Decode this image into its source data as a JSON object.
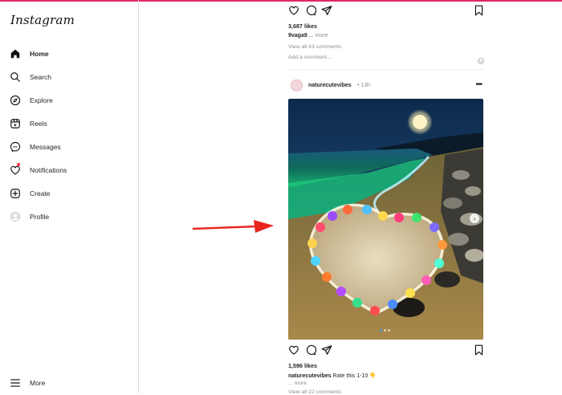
{
  "sidebar": {
    "logo": "Instagram",
    "items": [
      {
        "label": "Home",
        "icon": "home-icon"
      },
      {
        "label": "Search",
        "icon": "search-icon"
      },
      {
        "label": "Explore",
        "icon": "compass-icon"
      },
      {
        "label": "Reels",
        "icon": "reels-icon"
      },
      {
        "label": "Messages",
        "icon": "messenger-icon"
      },
      {
        "label": "Notifications",
        "icon": "heart-icon"
      },
      {
        "label": "Create",
        "icon": "plus-square-icon"
      },
      {
        "label": "Profile",
        "icon": "profile-avatar-icon"
      }
    ],
    "more_label": "More"
  },
  "prev_post": {
    "likes": "3,687 likes",
    "caption_user": "9vaga9",
    "caption_text": " ... ",
    "caption_more": "more",
    "view_comments": "View all 43 comments",
    "add_comment_placeholder": "Add a comment..."
  },
  "post": {
    "username": "naturecutevibes",
    "time": "• 13h",
    "image_alt": "Glowing heart of colorful pebbles on a moonlit beach",
    "likes": "1,596 likes",
    "caption_user": "naturecutevibes",
    "caption_text": "Rate this 1-10 👇",
    "caption_more": "... more",
    "view_comments": "View all 22 comments",
    "carousel_slides": 3,
    "carousel_active": 1
  },
  "colors": {
    "accent_bar": "#e3246b",
    "arrow": "#e8241c",
    "notification_dot": "#ff3040"
  }
}
